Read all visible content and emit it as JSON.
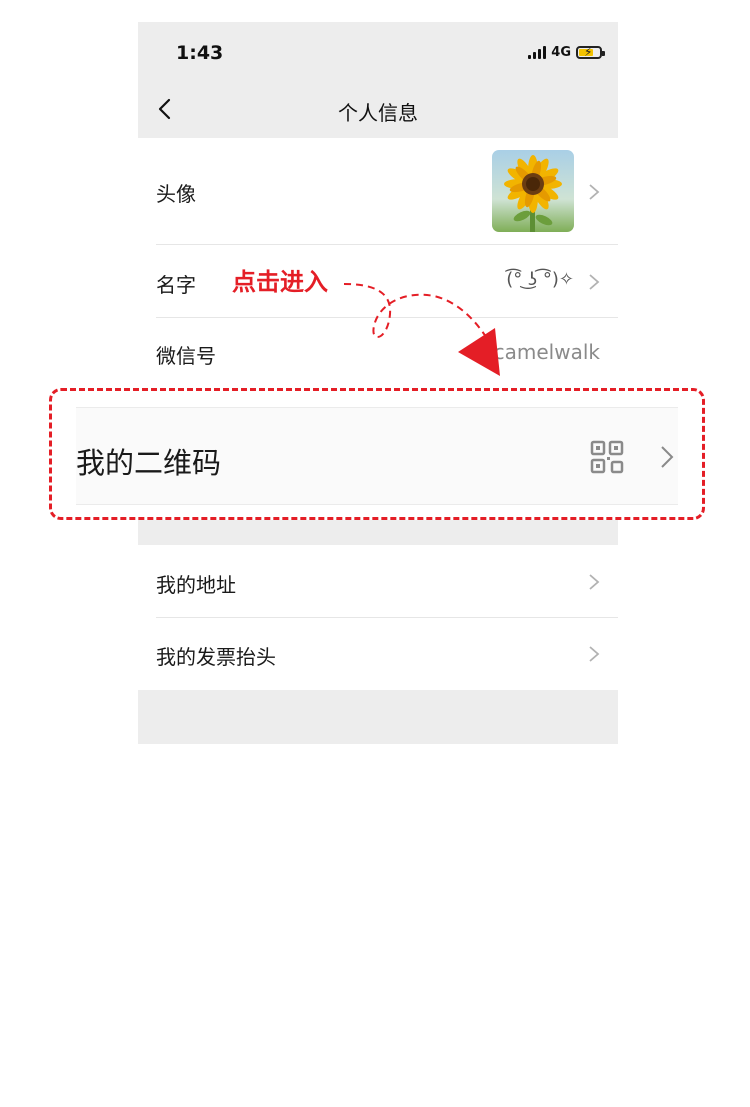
{
  "status_bar": {
    "time": "1:43",
    "network": "4G",
    "battery_color": "#f2c200"
  },
  "nav": {
    "title": "个人信息"
  },
  "rows": {
    "avatar_label": "头像",
    "name_label": "名字",
    "name_value": "(͡° ͜ʖ ͡°)✧",
    "wechat_id_label": "微信号",
    "wechat_id_value": "camelwalk",
    "qr_label": "我的二维码",
    "address_label": "我的地址",
    "invoice_label": "我的发票抬头"
  },
  "annotation": {
    "text": "点击进入",
    "color": "#e41e26"
  },
  "icons": {
    "back": "chevron-left-icon",
    "row_arrow": "chevron-right-icon",
    "qr": "qr-code-icon"
  }
}
